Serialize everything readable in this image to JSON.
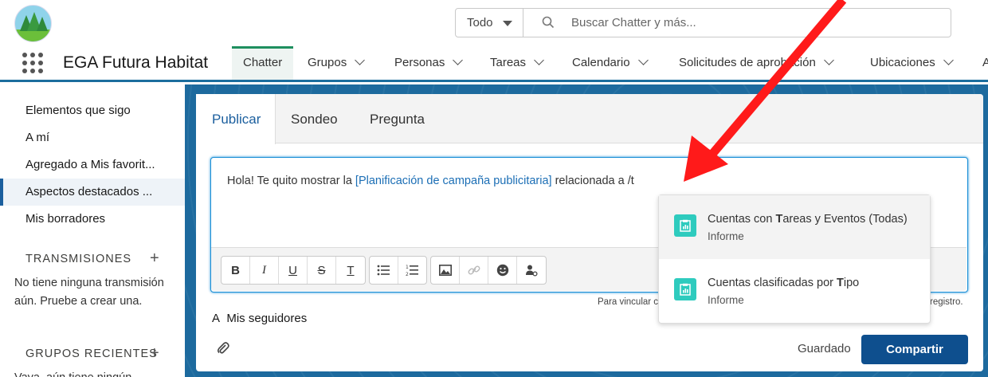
{
  "header": {
    "search_scope": "Todo",
    "search_placeholder": "Buscar Chatter y más..."
  },
  "nav": {
    "app_name": "EGA Futura Habitat",
    "tabs": [
      {
        "label": "Chatter"
      },
      {
        "label": "Grupos"
      },
      {
        "label": "Personas"
      },
      {
        "label": "Tareas"
      },
      {
        "label": "Calendario"
      },
      {
        "label": "Solicitudes de aprobación"
      },
      {
        "label": "Ubicaciones"
      },
      {
        "label": "A"
      }
    ]
  },
  "sidebar": {
    "items": [
      {
        "label": "Elementos que sigo"
      },
      {
        "label": "A mí"
      },
      {
        "label": "Agregado a Mis favorit..."
      },
      {
        "label": "Aspectos destacados ..."
      },
      {
        "label": "Mis borradores"
      }
    ],
    "streams_heading": "TRANSMISIONES",
    "streams_empty": "No tiene ninguna transmisión aún. Pruebe a crear una.",
    "recent_groups_heading": "GRUPOS RECIENTES",
    "recent_groups_text": "Vaya, aún tiene ningún"
  },
  "publisher": {
    "tabs": [
      {
        "label": "Publicar"
      },
      {
        "label": "Sondeo"
      },
      {
        "label": "Pregunta"
      }
    ],
    "message_before": "Hola! Te quito mostrar la ",
    "message_link": "[Planificación de campaña publicitaria]",
    "message_after": " relacionada a /t",
    "hint_left": "Para vincular c",
    "hint_right": "registro.",
    "audience_icon": "A",
    "audience": "Mis seguidores",
    "saved": "Guardado",
    "share": "Compartir"
  },
  "toolbar": {
    "bold": "B",
    "italic": "I",
    "underline": "U",
    "strike": "S",
    "clear": "T"
  },
  "dropdown": {
    "options": [
      {
        "before": "Cuentas con ",
        "bold": "T",
        "after": "areas y Eventos (Todas)",
        "type": "Informe"
      },
      {
        "before": "Cuentas clasificadas por ",
        "bold": "T",
        "after": "ipo",
        "type": "Informe"
      }
    ]
  },
  "colors": {
    "accent": "#0e4f8e",
    "banner": "#1d6a9e",
    "active_tab": "#1f8f5f",
    "report_icon": "#2ecbbe",
    "arrow": "#ff1a1a"
  }
}
